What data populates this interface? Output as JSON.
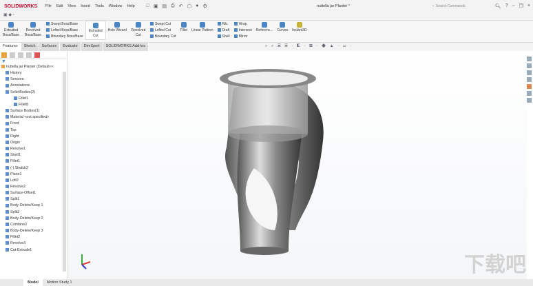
{
  "app": {
    "logo": "SOLIDWORKS",
    "menu": [
      "File",
      "Edit",
      "View",
      "Insert",
      "Tools",
      "Window",
      "Help"
    ],
    "doc_title": "nuttella jar Planter *",
    "search_placeholder": "Search Commands"
  },
  "ribbon": {
    "extruded_boss": "Extruded Boss/Base",
    "revolved_boss": "Revolved Boss/Base",
    "swept_boss": "Swept Boss/Base",
    "lofted_boss": "Lofted Boss/Base",
    "boundary_boss": "Boundary Boss/Base",
    "extruded_cut": "Extruded Cut",
    "hole_wizard": "Hole Wizard",
    "revolved_cut": "Revolved Cut",
    "swept_cut": "Swept Cut",
    "lofted_cut": "Lofted Cut",
    "boundary_cut": "Boundary Cut",
    "fillet": "Fillet",
    "linear_pattern": "Linear Pattern",
    "rib": "Rib",
    "draft": "Draft",
    "shell": "Shell",
    "wrap": "Wrap",
    "intersect": "Intersect",
    "mirror": "Mirror",
    "reference": "Referenc...",
    "curves": "Curves",
    "instant3d": "Instant3D"
  },
  "tabs": [
    "Features",
    "Sketch",
    "Surfaces",
    "Evaluate",
    "DimXpert",
    "SOLIDWORKS Add-Ins"
  ],
  "tree": [
    {
      "label": "nuttella jar Planter  (Default<<",
      "lvl": 0
    },
    {
      "label": "History",
      "lvl": 1
    },
    {
      "label": "Sensors",
      "lvl": 1
    },
    {
      "label": "Annotations",
      "lvl": 1
    },
    {
      "label": "Solid Bodies(2)",
      "lvl": 1
    },
    {
      "label": "Fillet1",
      "lvl": 2
    },
    {
      "label": "Fillet8",
      "lvl": 2
    },
    {
      "label": "Surface Bodies(1)",
      "lvl": 1
    },
    {
      "label": "Material <not specified>",
      "lvl": 1
    },
    {
      "label": "Front",
      "lvl": 1
    },
    {
      "label": "Top",
      "lvl": 1
    },
    {
      "label": "Right",
      "lvl": 1
    },
    {
      "label": "Origin",
      "lvl": 1
    },
    {
      "label": "Revolve1",
      "lvl": 1
    },
    {
      "label": "Shell1",
      "lvl": 1
    },
    {
      "label": "Fillet1",
      "lvl": 1
    },
    {
      "label": "(-) Sketch2",
      "lvl": 1
    },
    {
      "label": "Plane1",
      "lvl": 1
    },
    {
      "label": "Loft2",
      "lvl": 1
    },
    {
      "label": "Revolve2",
      "lvl": 1
    },
    {
      "label": "Surface-Offset1",
      "lvl": 1
    },
    {
      "label": "Split1",
      "lvl": 1
    },
    {
      "label": "Body-Delete/Keep 1",
      "lvl": 1
    },
    {
      "label": "Split2",
      "lvl": 1
    },
    {
      "label": "Body-Delete/Keep 2",
      "lvl": 1
    },
    {
      "label": "Combine2",
      "lvl": 1
    },
    {
      "label": "Body-Delete/Keep 3",
      "lvl": 1
    },
    {
      "label": "Fillet2",
      "lvl": 1
    },
    {
      "label": "Revolve3",
      "lvl": 1
    },
    {
      "label": "Cut-Extrude1",
      "lvl": 1
    }
  ],
  "bottom_tabs": [
    "Model",
    "Motion Study 1"
  ]
}
